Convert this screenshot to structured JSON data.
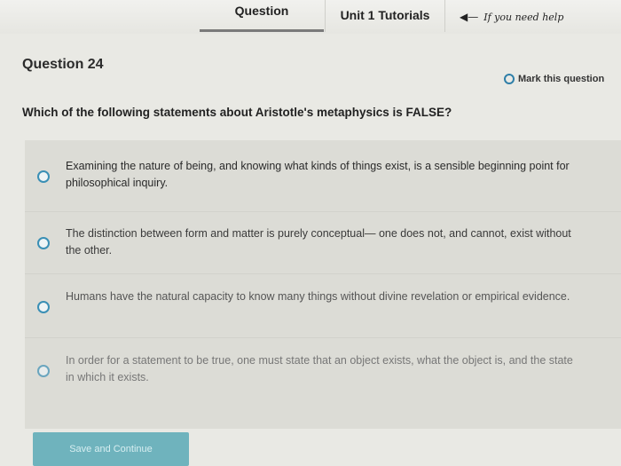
{
  "tabs": [
    {
      "label": "Question"
    },
    {
      "label": "Unit 1 Tutorials"
    }
  ],
  "annotation": "If you need help",
  "question": {
    "number": "Question 24",
    "mark_label": "Mark this question",
    "text": "Which of the following statements about Aristotle's metaphysics is FALSE?",
    "options": [
      {
        "text": "Examining the nature of being, and knowing what kinds of things exist, is a sensible beginning point for philosophical inquiry."
      },
      {
        "text": "The distinction between form and matter is purely conceptual— one does not, and cannot, exist without the other."
      },
      {
        "text": "Humans have the natural capacity to know many things without divine revelation or empirical evidence."
      },
      {
        "text": "In order for a statement to be true, one must state that an object exists, what the object is, and the state in which it exists."
      }
    ]
  },
  "submit_label": "Save and Continue",
  "colors": {
    "accent": "#3a8fb5",
    "button": "#6fb3bd"
  }
}
